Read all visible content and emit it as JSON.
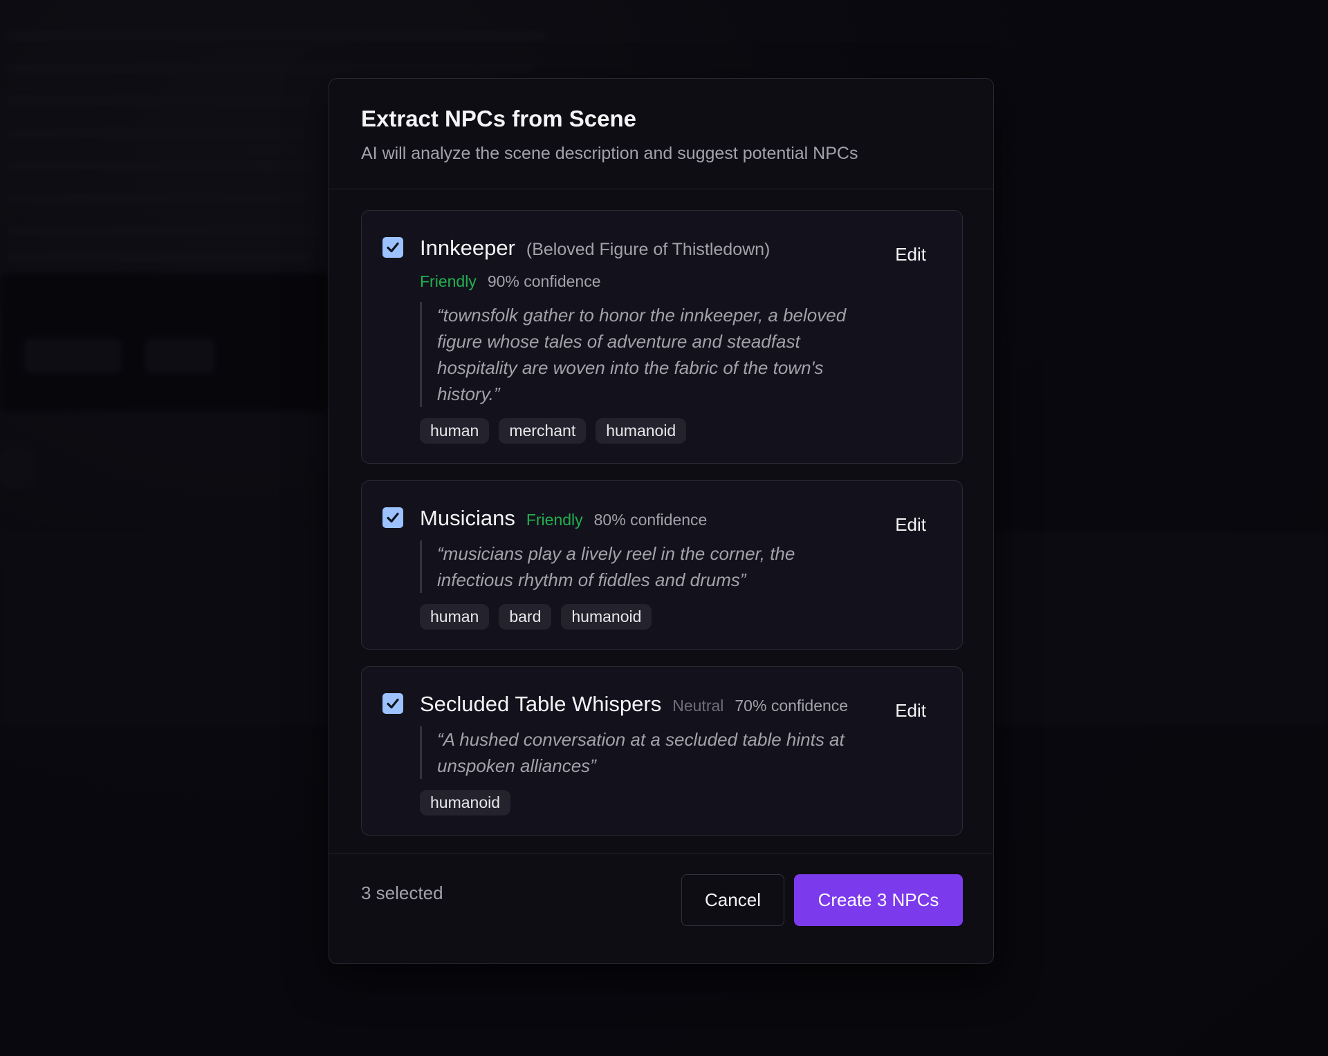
{
  "dialog": {
    "title": "Extract NPCs from Scene",
    "subtitle": "AI will analyze the scene description and suggest potential NPCs"
  },
  "npcs": [
    {
      "name": "Innkeeper",
      "subtitle": "(Beloved Figure of Thistledown)",
      "disposition": "Friendly",
      "confidence": "90% confidence",
      "quote": "“townsfolk gather to honor the innkeeper, a beloved figure whose tales of adventure and steadfast hospitality are woven into the fabric of the town's history.”",
      "tags": [
        "human",
        "merchant",
        "humanoid"
      ],
      "checked": true,
      "edit_label": "Edit"
    },
    {
      "name": "Musicians",
      "disposition": "Friendly",
      "confidence": "80% confidence",
      "quote": "“musicians play a lively reel in the corner, the infectious rhythm of fiddles and drums”",
      "tags": [
        "human",
        "bard",
        "humanoid"
      ],
      "checked": true,
      "edit_label": "Edit"
    },
    {
      "name": "Secluded Table Whispers",
      "disposition": "Neutral",
      "confidence": "70% confidence",
      "quote": "“A hushed conversation at a secluded table hints at unspoken alliances”",
      "tags": [
        "humanoid"
      ],
      "checked": true,
      "edit_label": "Edit"
    }
  ],
  "footer": {
    "selected_count": "3 selected",
    "cancel_label": "Cancel",
    "create_label": "Create 3 NPCs"
  },
  "colors": {
    "accent": "#7c3aed",
    "friendly": "#22b04e",
    "neutral": "#6f6e78",
    "checkbox": "#9cc2ff"
  },
  "icons": {
    "checkbox": "check-icon"
  }
}
